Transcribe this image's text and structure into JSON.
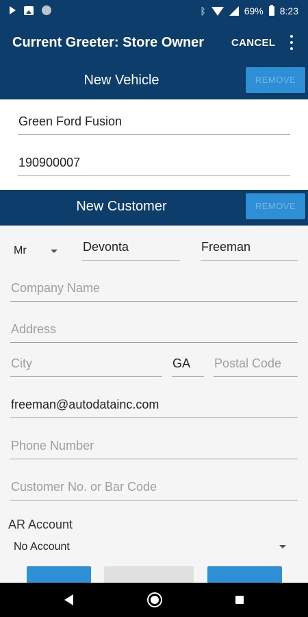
{
  "status_bar": {
    "battery": "69%",
    "time": "8:23",
    "icons": [
      "play-icon",
      "image-icon",
      "circle-icon",
      "bluetooth-icon",
      "wifi-icon",
      "signal-icon",
      "battery-icon"
    ]
  },
  "app_bar": {
    "title": "Current Greeter: Store Owner",
    "cancel_label": "CANCEL",
    "menu_icon": "more-vert-icon"
  },
  "vehicle": {
    "header": "New Vehicle",
    "remove_label": "REMOVE",
    "description": "Green Ford Fusion",
    "stock_number": "190900007"
  },
  "customer": {
    "header": "New Customer",
    "remove_label": "REMOVE",
    "salutation": "Mr",
    "first_name": "Devonta",
    "last_name": "Freeman",
    "company_placeholder": "Company Name",
    "address_placeholder": "Address",
    "city_placeholder": "City",
    "state": "GA",
    "postal_placeholder": "Postal Code",
    "email": "freeman@autodatainc.com",
    "phone_placeholder": "Phone Number",
    "customer_no_placeholder": "Customer No. or Bar Code",
    "ar_account_label": "AR Account",
    "ar_account_value": "No Account"
  },
  "colors": {
    "header_bg": "#0d3d6a",
    "remove_button_bg": "#2f8fd6",
    "accent_button": "#2f8fd6",
    "disabled_button": "#e0e0e0"
  },
  "nav_bar": {
    "icons": [
      "back-icon",
      "home-icon",
      "recents-icon"
    ]
  }
}
